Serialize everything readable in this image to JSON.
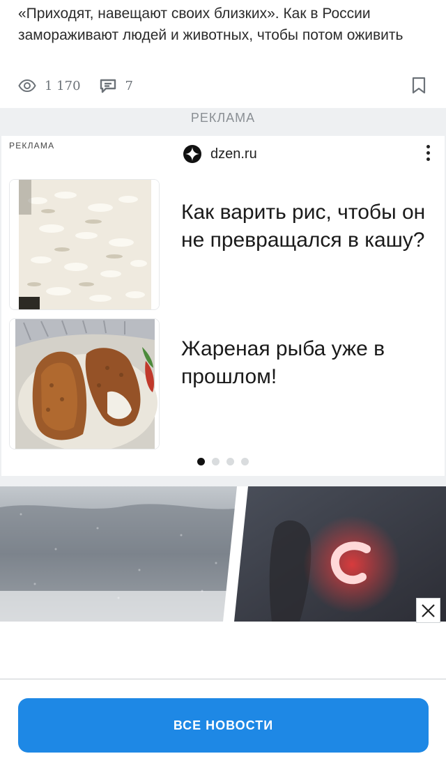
{
  "article": {
    "title": "«Приходят, навещают своих близких». Как в России замораживают людей и животных, чтобы потом оживить",
    "views": "1 170",
    "comments": "7"
  },
  "ad_band": {
    "label": "РЕКЛАМА"
  },
  "ad_card": {
    "label": "РЕКЛАМА",
    "source": "dzen.ru",
    "items": [
      {
        "text": "Как варить рис, чтобы он не превращался в кашу?",
        "image": "rice-photo"
      },
      {
        "text": "Жареная рыба уже в прошлом!",
        "image": "fried-fish-photo"
      }
    ],
    "carousel": {
      "total": 4,
      "active": 1
    }
  },
  "promo": {
    "image": "snowstorm-and-red-light-collage"
  },
  "footer": {
    "all_news_label": "ВСЕ НОВОСТИ"
  },
  "colors": {
    "accent": "#1e88e5",
    "band": "#eef0f2",
    "meta": "#6c7278"
  }
}
